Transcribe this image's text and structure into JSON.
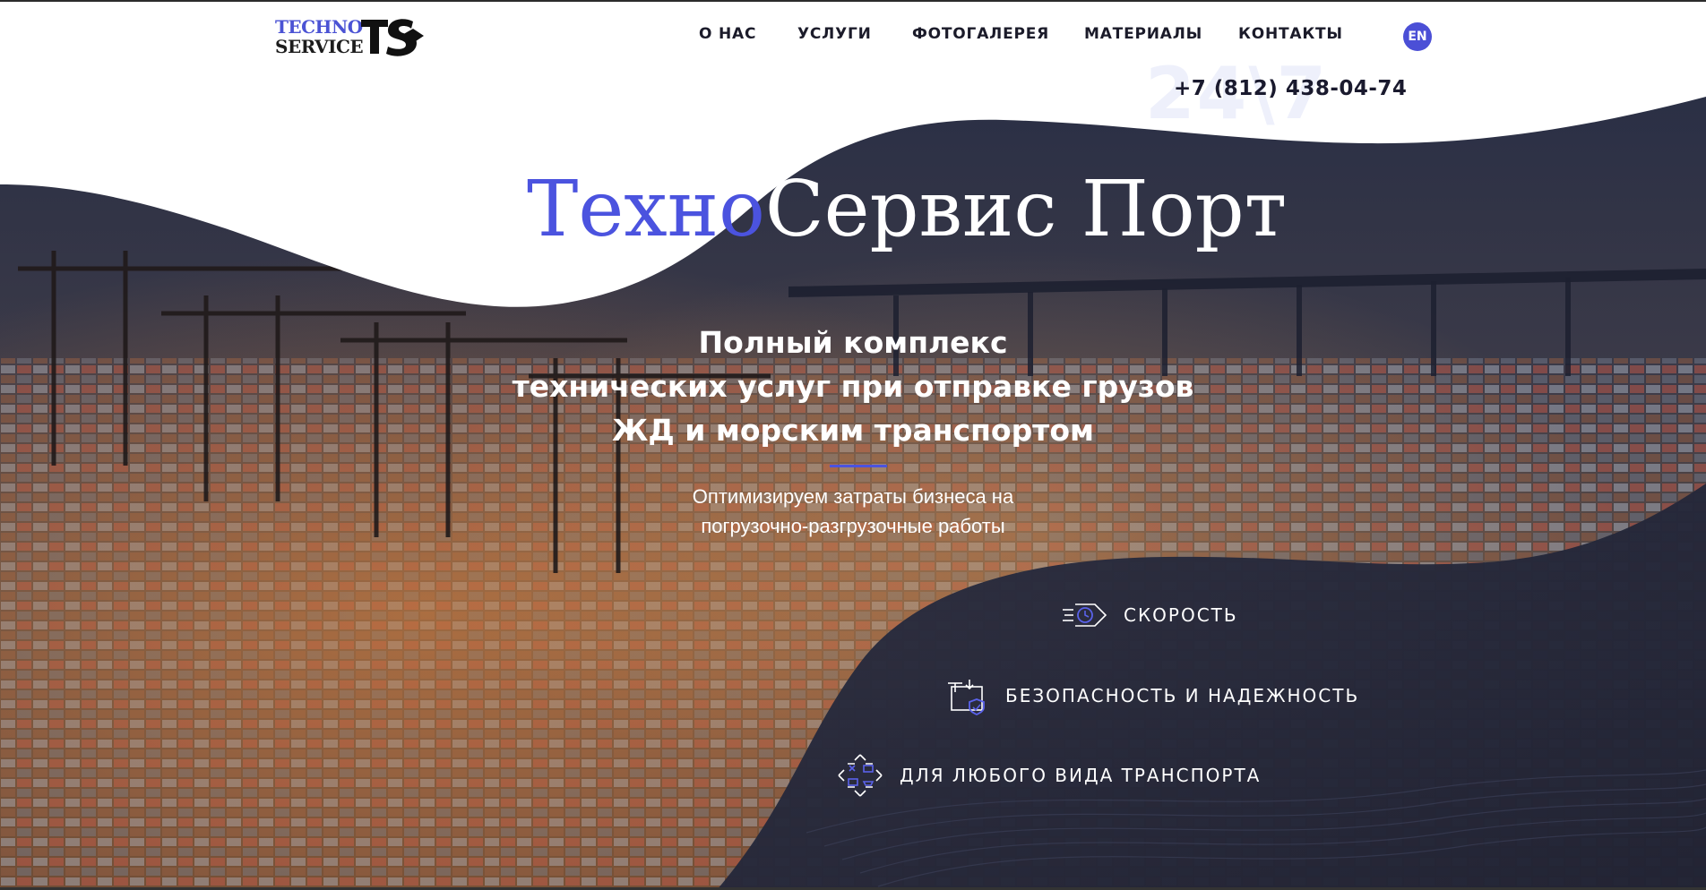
{
  "header": {
    "logo": {
      "line1": "TECHNO",
      "line2": "SERVICE",
      "mark": "TS"
    },
    "nav": [
      {
        "label": "О НАС"
      },
      {
        "label": "УСЛУГИ"
      },
      {
        "label": "ФОТОГАЛЕРЕЯ"
      },
      {
        "label": "МАТЕРИАЛЫ"
      },
      {
        "label": "КОНТАКТЫ"
      }
    ],
    "lang_button": "EN",
    "bg_text": "24\\7",
    "phone": "+7 (812) 438-04-74"
  },
  "hero": {
    "title_part1": "Техно",
    "title_part2": "Сервис Порт",
    "headline": [
      "Полный комплекс",
      "технических услуг при отправке грузов",
      "ЖД и морским транспортом"
    ],
    "subtitle": [
      "Оптимизируем затраты бизнеса на",
      "погрузочно-разгрузочные работы"
    ]
  },
  "features": [
    {
      "label": "СКОРОСТЬ",
      "icon": "speed-clock-icon"
    },
    {
      "label": "БЕЗОПАСНОСТЬ И НАДЕЖНОСТЬ",
      "icon": "cargo-shield-icon"
    },
    {
      "label": "ДЛЯ ЛЮБОГО ВИДА ТРАНСПОРТА",
      "icon": "transport-arrows-icon"
    }
  ],
  "colors": {
    "accent": "#4b53df",
    "dark": "#1b1b2a",
    "panel": "#232637"
  }
}
